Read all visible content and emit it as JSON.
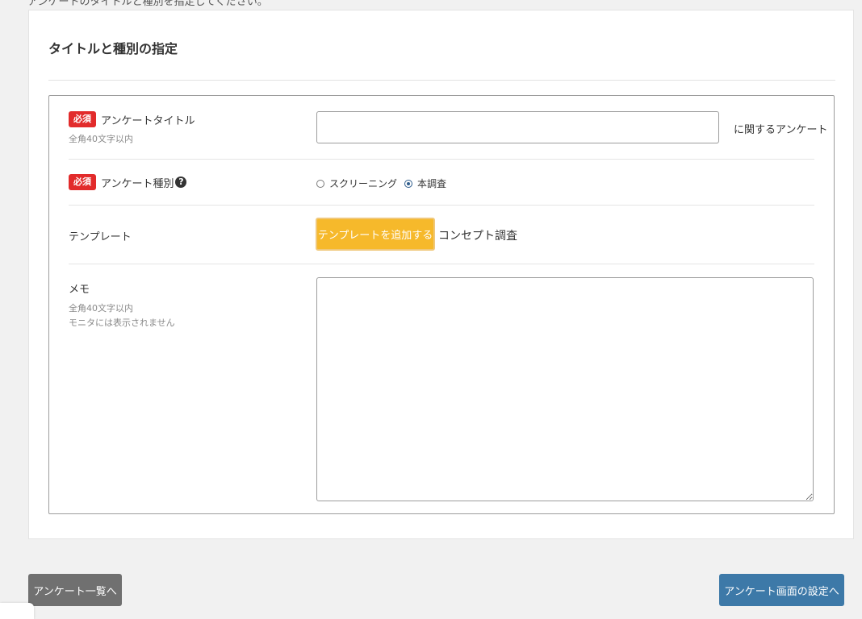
{
  "page": {
    "top_note": "アンケートのタイトルと種別を指定してください。"
  },
  "panel": {
    "title": "タイトルと種別の指定"
  },
  "form": {
    "survey_title": {
      "required_badge": "必須",
      "label": "アンケートタイトル",
      "hint": "全角40文字以内",
      "value": "",
      "placeholder": "",
      "suffix": "に関するアンケート"
    },
    "survey_type": {
      "required_badge": "必須",
      "label": "アンケート種別",
      "help_icon": "?",
      "options": [
        {
          "label": "スクリーニング",
          "checked": false
        },
        {
          "label": "本調査",
          "checked": true
        }
      ]
    },
    "template": {
      "label": "テンプレート",
      "add_button_label": "テンプレートを追加する",
      "selected_name": "コンセプト調査"
    },
    "memo": {
      "label": "メモ",
      "hint_lines": [
        "全角40文字以内",
        "モニタには表示されません"
      ],
      "value": ""
    }
  },
  "footer": {
    "back_button_label": "アンケート一覧へ",
    "next_button_label": "アンケート画面の設定へ"
  },
  "colors": {
    "required_badge": "#e22b2b",
    "template_button": "#f6b92b",
    "back_button": "#707070",
    "next_button": "#3d79a8",
    "page_background": "#f1f1f1"
  }
}
